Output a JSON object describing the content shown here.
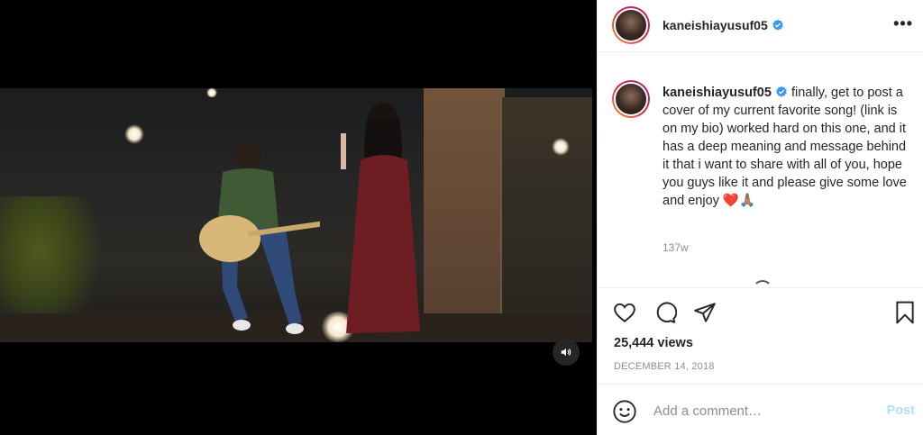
{
  "post": {
    "username": "kaneishiayusuf05",
    "caption_text": "finally, get to post a cover of my current favorite song! (link is on my bio) worked hard on this one, and it has a deep meaning and message behind it that i want to share with all of you, hope you guys like it and please give some love and enjoy",
    "caption_emojis": "❤️🙏🏽",
    "time_ago": "137w",
    "views": "25,444 views",
    "date": "DECEMBER 14, 2018"
  },
  "comment": {
    "placeholder": "Add a comment…",
    "post_label": "Post"
  },
  "icons": {
    "more": "more-options-icon",
    "like": "heart-icon",
    "comment": "comment-icon",
    "share": "share-icon",
    "save": "bookmark-icon",
    "emoji": "emoji-icon",
    "mute": "volume-icon",
    "verified": "verified-badge-icon"
  },
  "colors": {
    "verified": "#3897f0",
    "text": "#262626",
    "muted": "#8e8e8e",
    "post_disabled": "#b2dffc"
  }
}
